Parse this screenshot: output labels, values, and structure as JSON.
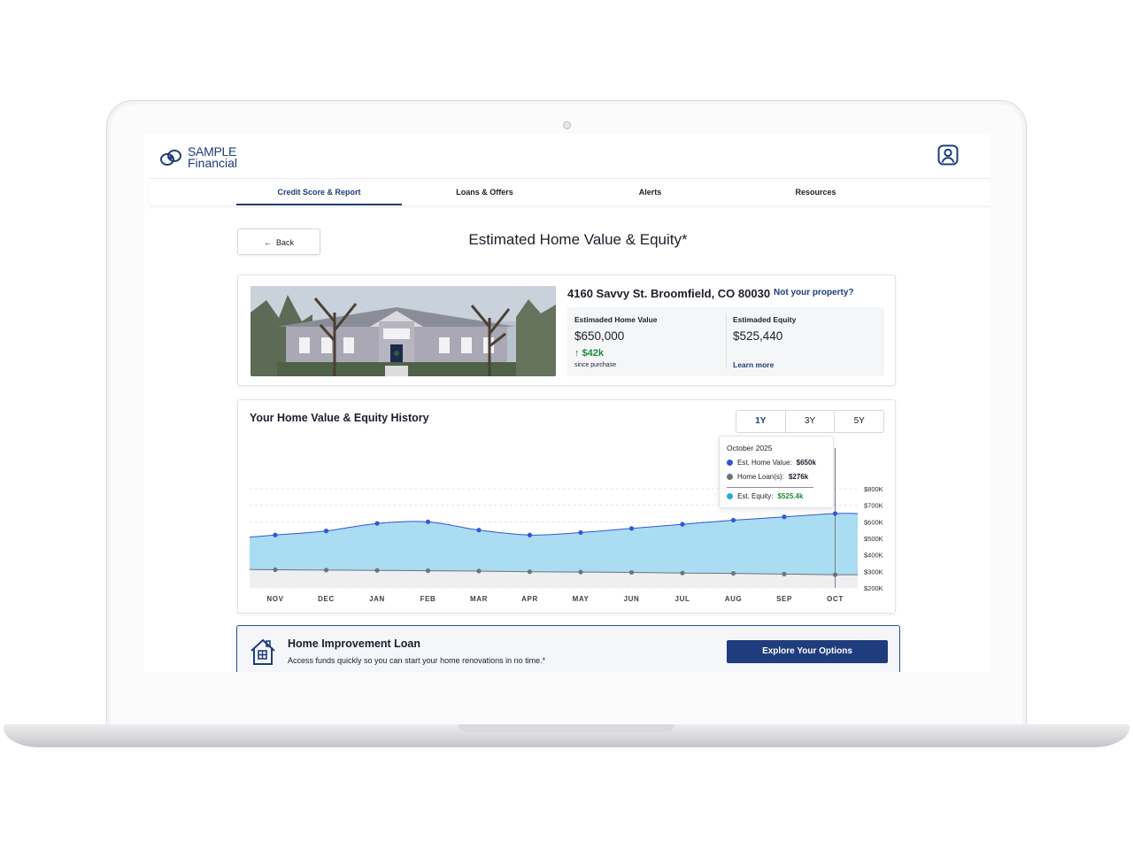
{
  "brand": {
    "line1": "SAMPLE",
    "line2": "Financial"
  },
  "nav": [
    {
      "label": "Credit Score & Report",
      "active": true
    },
    {
      "label": "Loans & Offers",
      "active": false
    },
    {
      "label": "Alerts",
      "active": false
    },
    {
      "label": "Resources",
      "active": false
    }
  ],
  "back_label": "Back",
  "page_title": "Estimated Home Value & Equity*",
  "property": {
    "address": "4160 Savvy St. Broomfield, CO 80030",
    "not_yours": "Not your property?",
    "home_value_label": "Estimaded Home Value",
    "home_value": "$650,000",
    "change": "$42k",
    "change_note": "since purchase",
    "equity_label": "Estimaded Equity",
    "equity": "$525,440",
    "learn_more": "Learn more"
  },
  "history": {
    "title": "Your Home Value & Equity History",
    "ranges": [
      "1Y",
      "3Y",
      "5Y"
    ],
    "selected_range": "1Y",
    "tooltip": {
      "date": "October 2025",
      "home_value_label": "Est. Home Value:",
      "home_value": "$650k",
      "loan_label": "Home Loan(s):",
      "loan": "$276k",
      "equity_label": "Est. Equity:",
      "equity": "$525.4k"
    }
  },
  "chart_data": {
    "type": "area",
    "categories": [
      "NOV",
      "DEC",
      "JAN",
      "FEB",
      "MAR",
      "APR",
      "MAY",
      "JUN",
      "JUL",
      "AUG",
      "SEP",
      "OCT"
    ],
    "y_ticks": [
      "$200K",
      "$300K",
      "$400K",
      "$500K",
      "$600K",
      "$700K",
      "$800K"
    ],
    "ylim": [
      200,
      800
    ],
    "series": [
      {
        "values": [
          520,
          545,
          590,
          600,
          550,
          520,
          535,
          560,
          585,
          610,
          630,
          650
        ],
        "color": "#3456d6",
        "fill": "#aadcf2"
      },
      {
        "values": [
          310,
          308,
          306,
          304,
          302,
          298,
          296,
          294,
          290,
          288,
          284,
          280
        ],
        "color": "#6f7278",
        "fill": "#eeeff1"
      }
    ],
    "highlight_index": 11,
    "grid": true
  },
  "promo": {
    "title": "Home Improvement Loan",
    "text": "Access funds quickly so you can start your home renovations in no time.*",
    "cta": "Explore Your Options"
  },
  "colors": {
    "brand": "#1f3c7c",
    "home_value_dot": "#3456d6",
    "loan_dot": "#6f7278",
    "equity_dot": "#29a8e0",
    "positive": "#1c8a3c"
  },
  "icons": {
    "logo": "sample-financial-logo-icon",
    "user": "user-profile-icon",
    "back": "arrow-left-icon",
    "change": "arrow-up-icon",
    "promo": "house-icon"
  }
}
